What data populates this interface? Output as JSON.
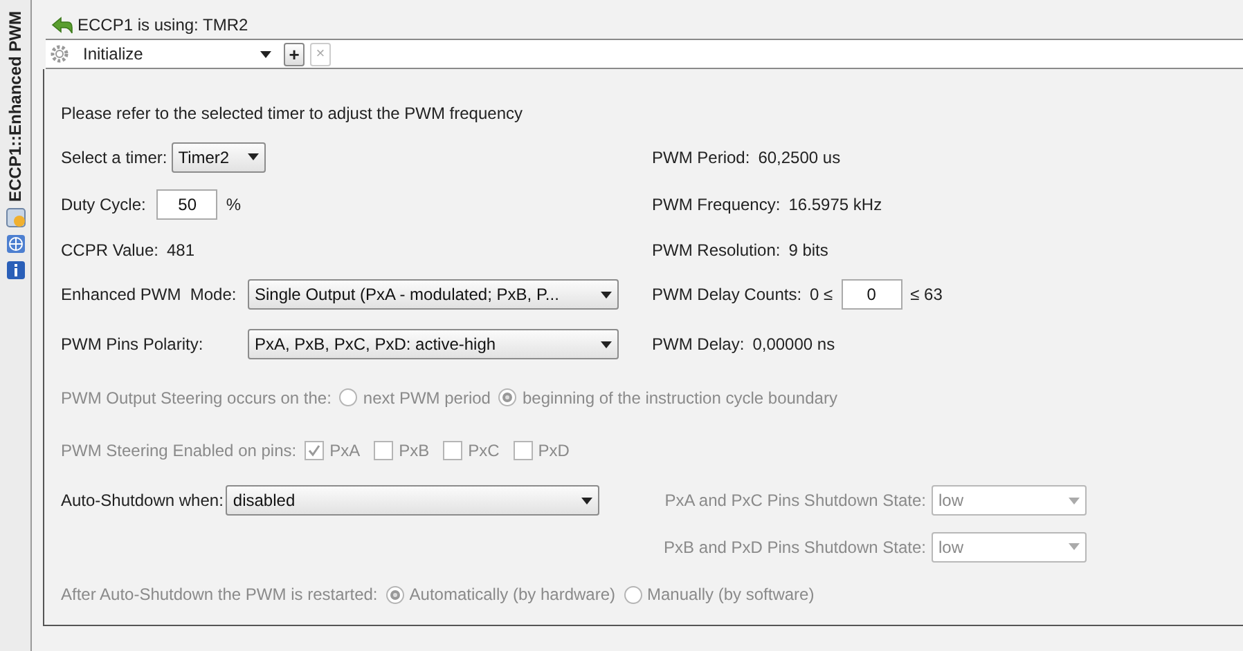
{
  "side_tab": {
    "label": "ECCP1::Enhanced PWM"
  },
  "header": {
    "text": "ECCP1 is using: TMR2"
  },
  "toolbar": {
    "action": {
      "value": "Initialize"
    },
    "add_button": {
      "label": "+",
      "disabled": false
    },
    "remove_button": {
      "label": "×",
      "disabled": true
    }
  },
  "info": "Please refer to the selected timer to adjust the PWM frequency",
  "timer": {
    "label": "Select a timer:",
    "value": "Timer2"
  },
  "duty_cycle": {
    "label": "Duty Cycle:",
    "value": "50",
    "unit": "%"
  },
  "ccpr": {
    "label": "CCPR Value:",
    "value": "481"
  },
  "mode": {
    "label": "Enhanced PWM  Mode:",
    "value": "Single Output (PxA - modulated; PxB, P..."
  },
  "polarity": {
    "label": "PWM Pins Polarity:",
    "value": "PxA, PxB, PxC, PxD: active-high"
  },
  "readouts": [
    {
      "label": "PWM Period:",
      "value": "60,2500 us"
    },
    {
      "label": "PWM Frequency:",
      "value": "16.5975 kHz"
    },
    {
      "label": "PWM Resolution:",
      "value": "9 bits"
    }
  ],
  "delay_counts": {
    "label": "PWM Delay Counts:",
    "min": "0 ≤",
    "value": "0",
    "max": "≤ 63"
  },
  "delay": {
    "label": "PWM Delay:",
    "value": "0,00000 ns"
  },
  "steering": {
    "label": "PWM Output Steering occurs on the:",
    "disabled": true,
    "options": [
      {
        "label": "next PWM period",
        "selected": false
      },
      {
        "label": "beginning of the instruction cycle boundary",
        "selected": true
      }
    ]
  },
  "steering_pins": {
    "label": "PWM Steering Enabled on pins:",
    "disabled": true,
    "pins": [
      {
        "label": "PxA",
        "checked": true
      },
      {
        "label": "PxB",
        "checked": false
      },
      {
        "label": "PxC",
        "checked": false
      },
      {
        "label": "PxD",
        "checked": false
      }
    ]
  },
  "auto_shutdown": {
    "label": "Auto-Shutdown when:",
    "value": "disabled"
  },
  "shutdown_states": [
    {
      "label": "PxA and PxC Pins Shutdown State:",
      "value": "low",
      "disabled": true
    },
    {
      "label": "PxB and PxD Pins Shutdown State:",
      "value": "low",
      "disabled": true
    }
  ],
  "restart": {
    "label": "After Auto-Shutdown the PWM is restarted:",
    "disabled": true,
    "options": [
      {
        "label": "Automatically (by hardware)",
        "selected": true
      },
      {
        "label": "Manually (by software)",
        "selected": false
      }
    ]
  }
}
